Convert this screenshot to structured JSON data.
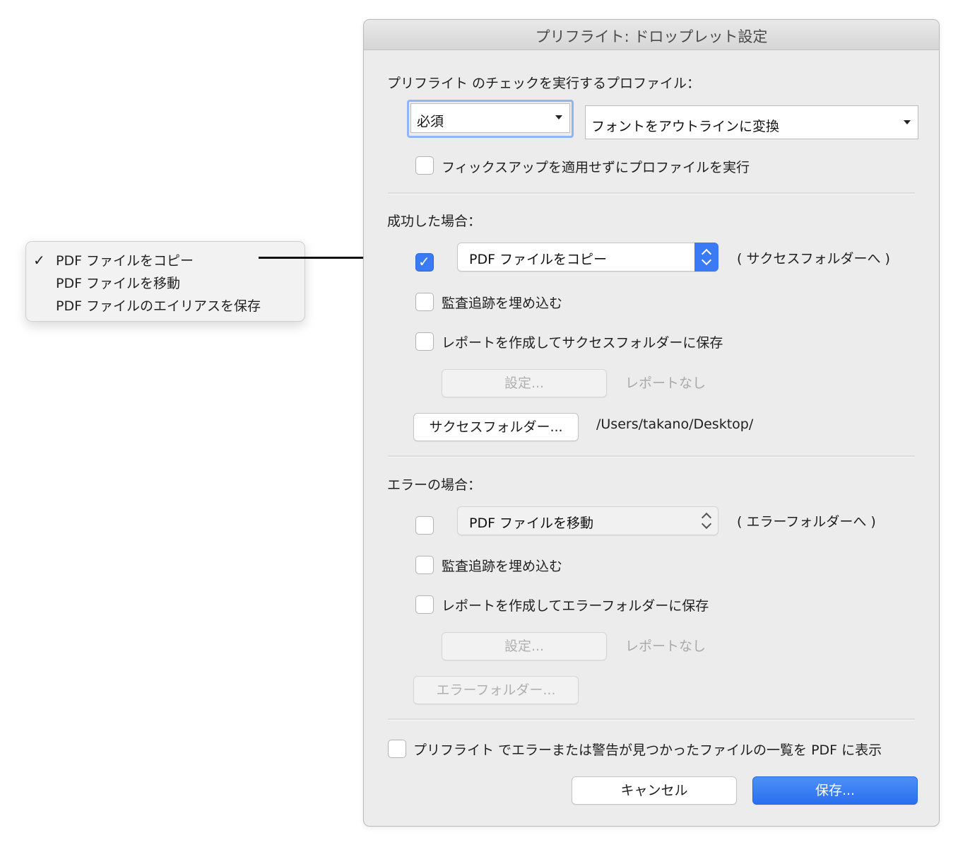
{
  "menu": {
    "items": [
      "PDF ファイルをコピー",
      "PDF ファイルを移動",
      "PDF ファイルのエイリアスを保存"
    ],
    "checked_index": 0,
    "check_glyph": "✓"
  },
  "dialog": {
    "title": "プリフライト: ドロップレット設定",
    "profile_section_label": "プリフライト のチェックを実行するプロファイル：",
    "profile_category": "必須",
    "profile_name": "フォントをアウトラインに変換",
    "run_without_fixups_label": "フィックスアップを適用せずにプロファイルを実行",
    "success": {
      "header": "成功した場合：",
      "action_select": "PDF ファイルをコピー",
      "action_checked": true,
      "destination_hint": "( サクセスフォルダーへ )",
      "embed_audit_label": "監査追跡を埋め込む",
      "report_label": "レポートを作成してサクセスフォルダーに保存",
      "settings_button": "設定...",
      "report_status": "レポートなし",
      "folder_button": "サクセスフォルダー...",
      "folder_path": "/Users/takano/Desktop/"
    },
    "error": {
      "header": "エラーの場合：",
      "action_select": "PDF ファイルを移動",
      "action_checked": false,
      "destination_hint": "( エラーフォルダーへ )",
      "embed_audit_label": "監査追跡を埋め込む",
      "report_label": "レポートを作成してエラーフォルダーに保存",
      "settings_button": "設定...",
      "report_status": "レポートなし",
      "folder_button": "エラーフォルダー..."
    },
    "show_list_label": "プリフライト でエラーまたは警告が見つかったファイルの一覧を PDF に表示",
    "cancel_button": "キャンセル",
    "save_button": "保存..."
  },
  "colors": {
    "accent": "#3a7af5",
    "dialog_bg": "#ececec",
    "disabled_text": "#a9a9a9"
  },
  "icons": {
    "checkbox_checked": "checkmark-icon",
    "popup_stepper": "up-down-chevron-icon",
    "select_arrow": "triangle-down-icon"
  }
}
